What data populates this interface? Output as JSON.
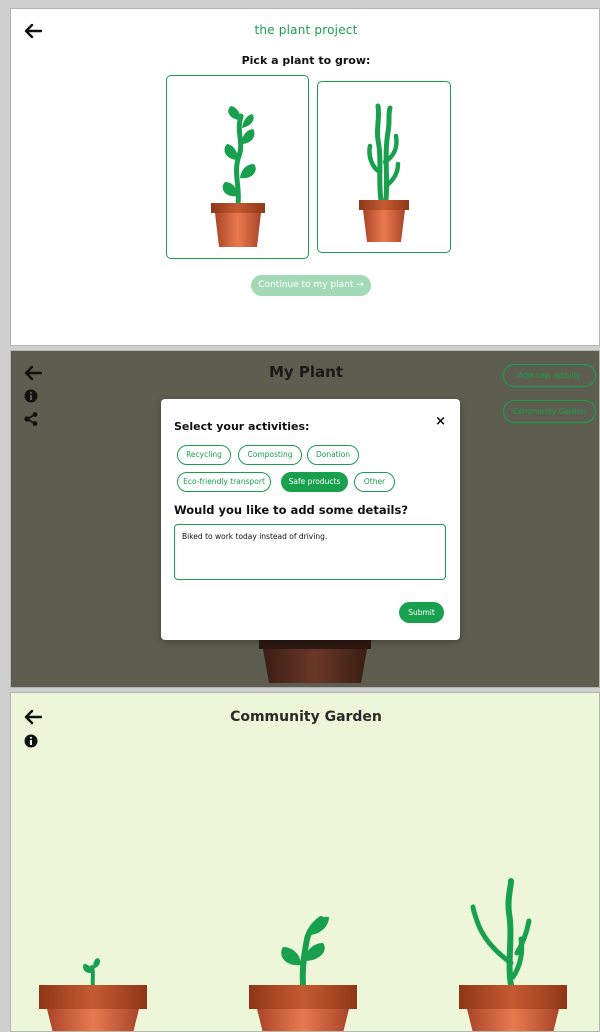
{
  "screen_pick": {
    "brand": "the plant project",
    "heading": "Pick a plant to grow:",
    "plants": [
      {
        "icon": "leafy-plant-icon"
      },
      {
        "icon": "cactus-plant-icon"
      }
    ],
    "continue_label": "Continue to my plant →"
  },
  "screen_my_plant": {
    "title": "My Plant",
    "add_activity_label": "Add new activity",
    "community_garden_label": "Community Garden",
    "modal": {
      "activities_heading": "Select your activities:",
      "activities": [
        {
          "label": "Recycling",
          "selected": false
        },
        {
          "label": "Composting",
          "selected": false
        },
        {
          "label": "Donation",
          "selected": false
        },
        {
          "label": "Eco-friendly transport",
          "selected": false
        },
        {
          "label": "Safe products",
          "selected": true
        },
        {
          "label": "Other",
          "selected": false
        }
      ],
      "details_heading": "Would you like to add some details?",
      "details_value": "Biked to work today instead of driving.",
      "close_symbol": "×",
      "submit_label": "Submit"
    }
  },
  "screen_garden": {
    "title": "Community Garden",
    "plants": [
      {
        "icon": "sprout-pot-icon"
      },
      {
        "icon": "leafy-pot-icon"
      },
      {
        "icon": "cactus-pot-icon"
      }
    ]
  },
  "colors": {
    "accent": "#18a04f",
    "accent_light": "#a3d9b5",
    "overlay": "#5e5e50",
    "garden_bg": "#edf6d8",
    "pot": "#c8603a"
  }
}
